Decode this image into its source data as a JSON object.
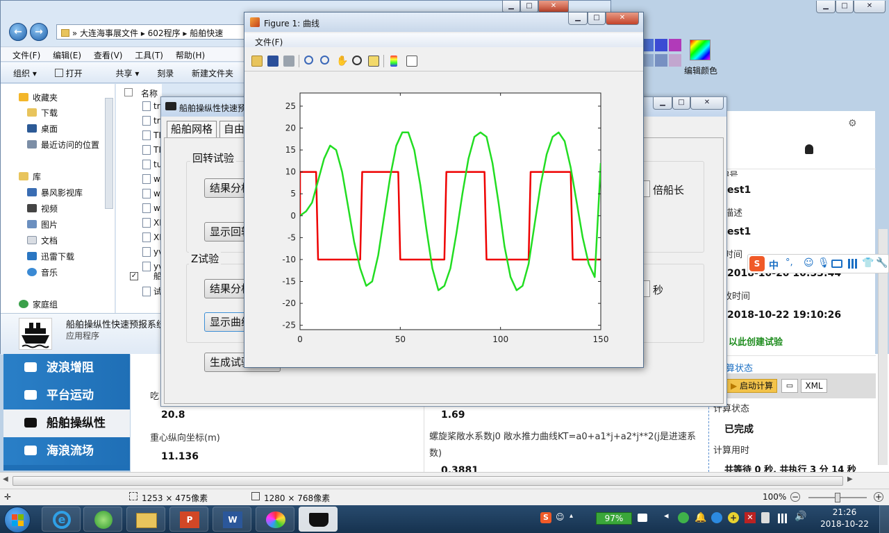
{
  "explorer": {
    "window_title_hint": "File Explorer",
    "address": [
      "大连海事展文件",
      "602程序",
      "船舶快速"
    ],
    "menu": [
      "文件(F)",
      "编辑(E)",
      "查看(V)",
      "工具(T)",
      "帮助(H)"
    ],
    "toolbar": [
      "组织 ▾",
      "打开",
      "共享 ▾",
      "刻录",
      "新建文件夹"
    ],
    "tree": {
      "favorites": "收藏夹",
      "fav_items": [
        "下载",
        "桌面",
        "最近访问的位置"
      ],
      "library": "库",
      "lib_items": [
        "暴风影视库",
        "视频",
        "图片",
        "文档",
        "迅雷下载",
        "音乐"
      ],
      "homegroup": "家庭组"
    },
    "files_header": "名称",
    "files": [
      "tr",
      "tr",
      "TI",
      "TI",
      "tu",
      "w",
      "w",
      "w",
      "XI",
      "XI",
      "yv",
      "yv",
      "船",
      "试"
    ],
    "detail_name": "船舶操纵性快速预报系统",
    "detail_type": "应用程序",
    "right_ribbon_label": "编辑颜色"
  },
  "sidenav": {
    "items": [
      "波浪增阻",
      "平台运动",
      "船舶操纵性",
      "海浪流场"
    ]
  },
  "content": {
    "label1": "吃",
    "val1": "20.8",
    "label2": "重心纵向坐标(m)",
    "val2": "11.136",
    "val3": "1.69",
    "label3": "螺旋桨敞水系数j0 敞水推力曲线KT=a0+a1*j+a2*j**2(j是进速系数)",
    "val4": "0.3881"
  },
  "rpanel": {
    "f1_label": "编号",
    "f1_val": "est1",
    "f2_label": "描述",
    "f2_val": "est1",
    "f3_label": "时间",
    "f3_val": "2018-10-20 10:53:44",
    "f4_label": "改时间",
    "f4_val": "2018-10-22 19:10:26",
    "create_link": "以此创建试验",
    "calc_status_title": "算状态",
    "start_btn": "启动计算",
    "xml_btn": "XML",
    "calc_label": "计算状态",
    "calc_val": "已完成",
    "time_label": "计算用时",
    "time_val": "共等待 0 秒, 共执行 3 分 14 秒"
  },
  "ime": {
    "lang": "中"
  },
  "dialog": {
    "title": "船舶操纵性快速预",
    "tabs": [
      "船舶网格",
      "自由"
    ],
    "group1": "回转试验",
    "btn1": "结果分析",
    "btn2": "显示回转",
    "unit1": "倍船长",
    "group2": "Z试验",
    "btn3": "结果分析",
    "btn4": "显示曲线",
    "unit2": "秒",
    "btn5": "生成试验"
  },
  "figure": {
    "title": "Figure 1: 曲线",
    "menu": "文件(F)"
  },
  "chart_data": {
    "type": "line",
    "xlim": [
      0,
      150
    ],
    "ylim": [
      -26,
      28
    ],
    "xticks": [
      0,
      50,
      100,
      150
    ],
    "yticks": [
      25,
      20,
      15,
      10,
      5,
      0,
      -5,
      -10,
      -15,
      -20,
      -25
    ],
    "grid": false,
    "series": [
      {
        "color": "#ee0000",
        "x": [
          0,
          0,
          8,
          9,
          30,
          31,
          49,
          50,
          72,
          73,
          92,
          93,
          114,
          115,
          135,
          136,
          150
        ],
        "y": [
          0,
          10,
          10,
          -10,
          -10,
          10,
          10,
          -10,
          -10,
          10,
          10,
          -10,
          -10,
          10,
          10,
          -10,
          -10
        ]
      },
      {
        "color": "#22dd22",
        "x": [
          0,
          3,
          6,
          9,
          12,
          15,
          18,
          21,
          24,
          27,
          30,
          33,
          36,
          39,
          42,
          45,
          48,
          51,
          54,
          57,
          60,
          63,
          66,
          69,
          72,
          75,
          78,
          81,
          84,
          87,
          90,
          93,
          96,
          99,
          102,
          105,
          108,
          111,
          114,
          117,
          120,
          123,
          126,
          129,
          132,
          135,
          138,
          141,
          144,
          147,
          150
        ],
        "y": [
          0,
          1,
          3,
          8,
          13,
          16,
          15,
          10,
          2,
          -6,
          -12,
          -16,
          -15,
          -9,
          0,
          9,
          16,
          19,
          19,
          15,
          7,
          -3,
          -12,
          -17,
          -16,
          -12,
          -4,
          5,
          13,
          18,
          19,
          18,
          12,
          3,
          -7,
          -14,
          -17,
          -16,
          -11,
          -2,
          7,
          14,
          18,
          19,
          17,
          11,
          3,
          -5,
          -11,
          -14,
          12
        ]
      }
    ]
  },
  "statusbar": {
    "selection": "1253 × 475像素",
    "size": "1280 × 768像素",
    "zoom": "100%"
  },
  "taskbar": {
    "battery": "97%",
    "time": "21:26",
    "date": "2018-10-22"
  }
}
